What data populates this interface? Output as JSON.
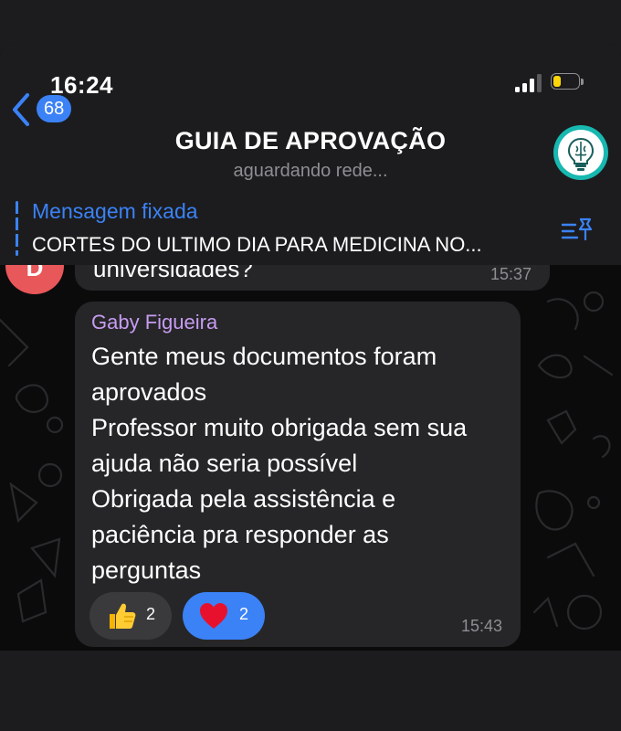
{
  "status_bar": {
    "time": "16:24",
    "signal_bars": 3,
    "battery_level": 0.3
  },
  "header": {
    "back_count": "68",
    "title": "GUIA DE APROVAÇÃO",
    "status": "aguardando rede...",
    "avatar_icon": "lightbulb-brain-icon"
  },
  "pinned": {
    "label": "Mensagem fixada",
    "text": "CORTES DO ULTIMO DIA PARA MEDICINA NO..."
  },
  "previous_message": {
    "avatar_letter": "D",
    "text_partial": "universidades?",
    "time": "15:37"
  },
  "message": {
    "sender": "Gaby Figueira",
    "lines": [
      "Gente meus documentos foram",
      "aprovados",
      "Professor muito obrigada sem sua",
      "ajuda não seria possível",
      "Obrigada pela assistência e",
      "paciência pra responder as",
      "perguntas"
    ],
    "time": "15:43",
    "reactions": [
      {
        "emoji": "thumbs-up",
        "count": "2",
        "selected": false
      },
      {
        "emoji": "red-heart",
        "count": "2",
        "selected": true
      }
    ]
  },
  "colors": {
    "accent": "#3b82f6",
    "sender_name": "#c79cf2",
    "bubble": "#262628",
    "background": "#0b0b0c",
    "bar": "#1c1c1e"
  }
}
